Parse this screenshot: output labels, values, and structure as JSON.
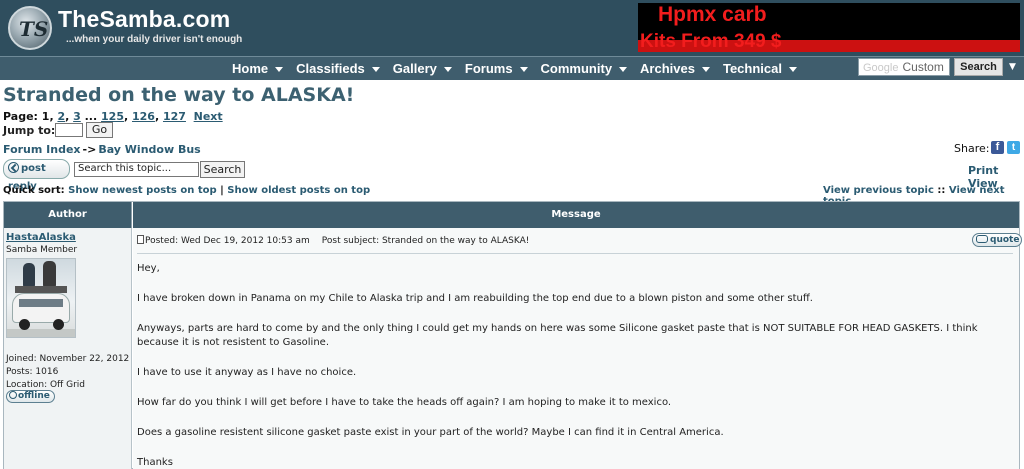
{
  "header": {
    "logo_mark": "TS",
    "site_name": "TheSamba.com",
    "tagline": "...when your daily driver isn't enough",
    "ad_line1": "Hpmx carb",
    "ad_line2": "Kits From 349 $"
  },
  "nav": {
    "items": [
      "Home",
      "Classifieds",
      "Gallery",
      "Forums",
      "Community",
      "Archives",
      "Technical"
    ],
    "search_placeholder_brand": "Google",
    "search_placeholder": "Custom",
    "search_button": "Search"
  },
  "topic": {
    "title": "Stranded on the way to ALASKA!",
    "page_label": "Page:",
    "current_page": "1",
    "pages": [
      "2",
      "3"
    ],
    "ellipsis": "...",
    "pages_end": [
      "125",
      "126",
      "127"
    ],
    "next": "Next",
    "jump_label": "Jump to:",
    "go_button": "Go"
  },
  "breadcrumb": {
    "root": "Forum Index",
    "sep": "->",
    "current": "Bay Window Bus"
  },
  "share": {
    "label": "Share:",
    "print_view": "Print View"
  },
  "actions": {
    "post_reply": "post reply",
    "search_topic_value": "Search this topic...",
    "search_button": "Search"
  },
  "sort": {
    "label": "Quick sort:",
    "newest": "Show newest posts on top",
    "sep": "|",
    "oldest": "Show oldest posts on top",
    "prev_topic": "View previous topic",
    "topic_sep": "::",
    "next_topic": "View next topic"
  },
  "table": {
    "author_header": "Author",
    "message_header": "Message"
  },
  "post": {
    "author": "HastaAlaska",
    "rank": "Samba Member",
    "joined": "Joined: November 22, 2012",
    "posts": "Posts: 1016",
    "location": "Location: Off Grid",
    "status": "offline",
    "posted": "Posted: Wed Dec 19, 2012 10:53 am",
    "subject": "Post subject: Stranded on the way to ALASKA!",
    "quote_button": "quote",
    "body": [
      "Hey,",
      "I have broken down in Panama on my Chile to Alaska trip and I am reabuilding the top end due to a blown piston and some other stuff.",
      "Anyways, parts are hard to come by and the only thing I could get my hands on here was some Silicone gasket paste that is NOT SUITABLE FOR HEAD GASKETS. I think because it is not resistent to Gasoline.",
      "I have to use it anyway as I have no choice.",
      "How far do you think I will get before I have to take the heads off again? I am hoping to make it to mexico.",
      "Does a gasoline resistent silicone gasket paste exist in your part of the world? Maybe I can find it in Central America.",
      "Thanks"
    ]
  },
  "icons": {
    "facebook": "f",
    "twitter": "t",
    "scroll_arrow": "▼"
  }
}
